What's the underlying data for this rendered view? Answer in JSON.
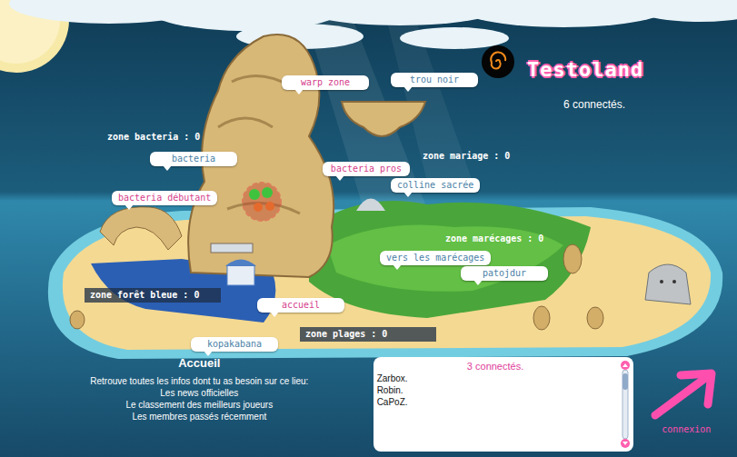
{
  "header": {
    "title": "Testoland",
    "online_count": "6 connectés."
  },
  "places": [
    {
      "label": "warp zone",
      "color": "#d6408c"
    },
    {
      "label": "trou noir",
      "color": "#4a7fa6"
    },
    {
      "label": "bacteria",
      "color": "#4a7fa6"
    },
    {
      "label": "bacteria pros",
      "color": "#d6408c"
    },
    {
      "label": "bacteria débutant",
      "color": "#d6408c"
    },
    {
      "label": "colline sacrée",
      "color": "#4a7fa6"
    },
    {
      "label": "vers les marécages",
      "color": "#4a7fa6"
    },
    {
      "label": "patojdur",
      "color": "#4a7fa6"
    },
    {
      "label": "accueil",
      "color": "#d6408c"
    },
    {
      "label": "kopakabana",
      "color": "#4a7fa6"
    }
  ],
  "zones": [
    {
      "label": "zone bacteria : 0",
      "kind": "plain"
    },
    {
      "label": "zone mariage : 0",
      "kind": "plain"
    },
    {
      "label": "zone marécages : 0",
      "kind": "plain"
    },
    {
      "label": "zone forêt bleue : 0",
      "kind": "banner"
    },
    {
      "label": "zone plages : 0",
      "kind": "banner"
    }
  ],
  "info": {
    "title": "Accueil",
    "intro": "Retrouve toutes les infos dont tu as besoin sur ce lieu:",
    "links": [
      "Les news officielles",
      "Le classement des meilleurs joueurs",
      "Les membres passés récemment"
    ]
  },
  "online_box": {
    "title": "3 connectés.",
    "members": [
      "Zarbox.",
      "Robin.",
      "CaPoZ."
    ]
  },
  "login": {
    "label": "connexion"
  }
}
